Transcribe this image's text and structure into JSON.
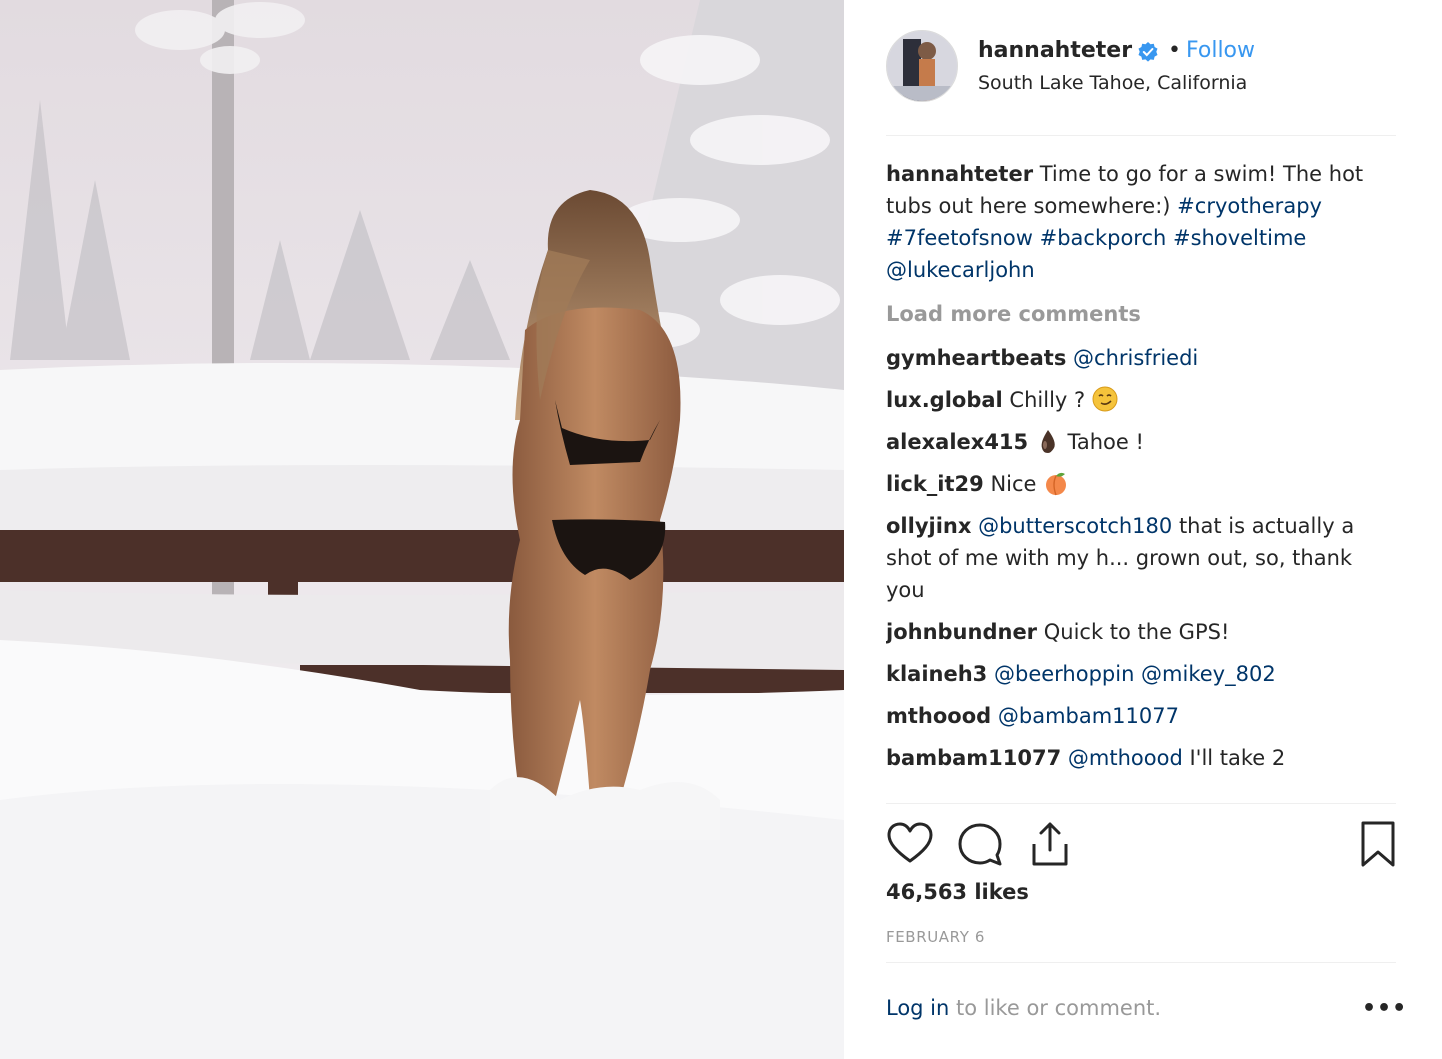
{
  "post": {
    "username": "hannahteter",
    "follow_label": "Follow",
    "separator": "•",
    "location": "South Lake Tahoe, California"
  },
  "caption": {
    "username": "hannahteter",
    "text": "Time to go for a swim! The hot tubs out here somewhere:)",
    "tags": "#cryotherapy #7feetofsnow #backporch #shoveltime @lukecarljohn"
  },
  "load_more": "Load more comments",
  "comments": [
    {
      "user": "gymheartbeats",
      "mention": "@chrisfriedi",
      "text": ""
    },
    {
      "user": "lux.global",
      "mention": "",
      "text": "Chilly ?",
      "emoji": "smirk-face-emoji"
    },
    {
      "user": "alexalex415",
      "mention": "",
      "text": "Tahoe !",
      "emoji": "water-drop-emoji"
    },
    {
      "user": "lick_it29",
      "mention": "",
      "text": "Nice",
      "emoji": "peach-emoji"
    },
    {
      "user": "ollyjinx",
      "mention": "@butterscotch180",
      "text": "that is actually a shot of me with my h... grown out, so, thank you"
    },
    {
      "user": "johnbundner",
      "mention": "",
      "text": "Quick to the GPS!"
    },
    {
      "user": "klaineh3",
      "mention": "@beerhoppin @mikey_802",
      "text": ""
    },
    {
      "user": "mthoood",
      "mention": "@bambam11077",
      "text": ""
    },
    {
      "user": "bambam11077",
      "mention": "@mthoood",
      "text": "I'll take 2"
    }
  ],
  "actions": {
    "like_icon": "heart-icon",
    "comment_icon": "comment-icon",
    "share_icon": "share-icon",
    "save_icon": "bookmark-icon"
  },
  "likes": "46,563 likes",
  "date": "FEBRUARY 6",
  "login": {
    "link": "Log in",
    "text": " to like or comment."
  },
  "more_options": "•••",
  "colors": {
    "link_blue": "#3897f0",
    "mention": "#003569",
    "muted": "#999999",
    "verified": "#3897f0"
  }
}
